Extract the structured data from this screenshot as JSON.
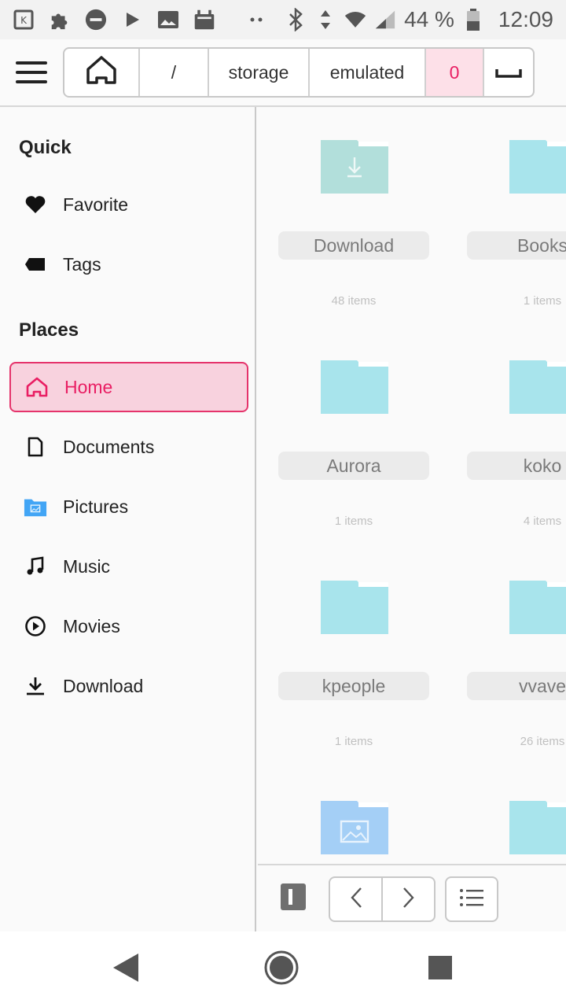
{
  "status_bar": {
    "battery_text": "44 %",
    "time": "12:09",
    "left_icons": [
      "kde-connect-icon",
      "puzzle-icon",
      "do-not-disturb-icon",
      "play-icon",
      "image-icon",
      "android-icon",
      "dots-icon"
    ]
  },
  "breadcrumb": {
    "segments": [
      "/",
      "storage",
      "emulated",
      "0"
    ],
    "active_index": 3,
    "home_icon": "home-outline-icon"
  },
  "sidebar": {
    "sections": [
      {
        "title": "Quick",
        "items": [
          {
            "label": "Favorite",
            "icon": "heart-icon"
          },
          {
            "label": "Tags",
            "icon": "tag-icon"
          }
        ]
      },
      {
        "title": "Places",
        "items": [
          {
            "label": "Home",
            "icon": "home-icon",
            "selected": true
          },
          {
            "label": "Documents",
            "icon": "document-icon"
          },
          {
            "label": "Pictures",
            "icon": "pictures-folder-icon"
          },
          {
            "label": "Music",
            "icon": "music-note-icon"
          },
          {
            "label": "Movies",
            "icon": "play-circle-icon"
          },
          {
            "label": "Download",
            "icon": "download-icon"
          }
        ]
      }
    ]
  },
  "folders": [
    {
      "name": "Download",
      "count": "48 items",
      "color": "#b2dfdb",
      "badge": "download"
    },
    {
      "name": "Books",
      "count": "1 items",
      "color": "#a8e4ec"
    },
    {
      "name": "Aurora",
      "count": "1 items",
      "color": "#a8e4ec"
    },
    {
      "name": "koko",
      "count": "4 items",
      "color": "#a8e4ec"
    },
    {
      "name": "kpeople",
      "count": "1 items",
      "color": "#a8e4ec"
    },
    {
      "name": "vvave",
      "count": "26 items",
      "color": "#a8e4ec"
    },
    {
      "name": "",
      "count": "",
      "color": "#a4cff6",
      "badge": "image"
    },
    {
      "name": "",
      "count": "",
      "color": "#a8e4ec"
    }
  ],
  "colors": {
    "accent": "#e91e63",
    "accent_bg": "#f8d2de",
    "folder_teal": "#a8e4ec"
  }
}
